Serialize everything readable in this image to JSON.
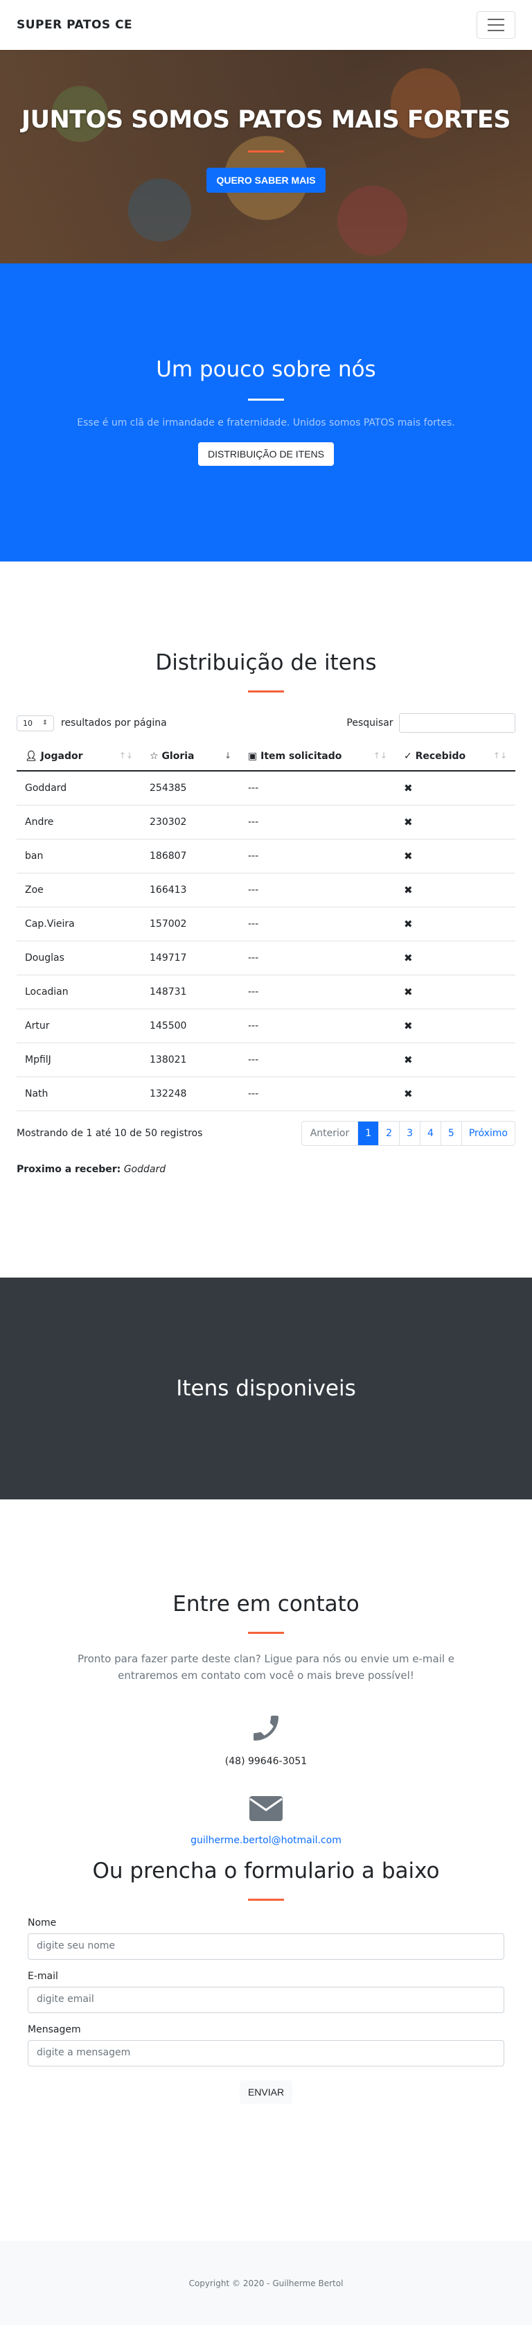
{
  "nav": {
    "brand": "SUPER PATOS CE"
  },
  "hero": {
    "title": "JUNTOS SOMOS PATOS MAIS FORTES",
    "cta": "QUERO SABER MAIS"
  },
  "about": {
    "title": "Um pouco sobre nós",
    "text": "Esse é um clã de irmandade e fraternidade. Unidos somos PATOS mais fortes.",
    "cta": "DISTRIBUIÇÃO DE ITENS"
  },
  "distribution": {
    "title": "Distribuição de itens",
    "page_size": "10",
    "page_size_label": "resultados por página",
    "search_label": "Pesquisar",
    "columns": [
      "Jogador",
      "Gloria",
      "Item solicitado",
      "Recebido"
    ],
    "rows": [
      {
        "player": "Goddard",
        "gloria": "254385",
        "item": "---",
        "received": "✖"
      },
      {
        "player": "Andre",
        "gloria": "230302",
        "item": "---",
        "received": "✖"
      },
      {
        "player": "ban",
        "gloria": "186807",
        "item": "---",
        "received": "✖"
      },
      {
        "player": "Zoe",
        "gloria": "166413",
        "item": "---",
        "received": "✖"
      },
      {
        "player": "Cap.Vieira",
        "gloria": "157002",
        "item": "---",
        "received": "✖"
      },
      {
        "player": "Douglas",
        "gloria": "149717",
        "item": "---",
        "received": "✖"
      },
      {
        "player": "Locadian",
        "gloria": "148731",
        "item": "---",
        "received": "✖"
      },
      {
        "player": "Artur",
        "gloria": "145500",
        "item": "---",
        "received": "✖"
      },
      {
        "player": "MpfilJ",
        "gloria": "138021",
        "item": "---",
        "received": "✖"
      },
      {
        "player": "Nath",
        "gloria": "132248",
        "item": "---",
        "received": "✖"
      }
    ],
    "info": "Mostrando de 1 até 10 de 50 registros",
    "pagination": {
      "prev": "Anterior",
      "pages": [
        "1",
        "2",
        "3",
        "4",
        "5"
      ],
      "current": "1",
      "next": "Próximo"
    },
    "next_label": "Proximo a receber:",
    "next_value": "Goddard"
  },
  "items": {
    "title": "Itens disponiveis"
  },
  "contact": {
    "title": "Entre em contato",
    "lead": "Pronto para fazer parte deste clan? Ligue para nós ou envie um e-mail e entraremos em contato com você o mais breve possível!",
    "phone": "(48) 99646-3051",
    "email": "guilherme.bertol@hotmail.com",
    "form_title": "Ou prencha o formulario a baixo",
    "name_label": "Nome",
    "name_placeholder": "digite seu nome",
    "email_label": "E-mail",
    "email_placeholder": "digite email",
    "message_label": "Mensagem",
    "message_placeholder": "digite a mensagem",
    "send": "ENVIAR"
  },
  "footer": {
    "text": "Copyright © 2020 - Guilherme Bertol"
  },
  "colors": {
    "primary": "#0d6efd",
    "accent": "#f4623a",
    "dark": "#343a40"
  }
}
